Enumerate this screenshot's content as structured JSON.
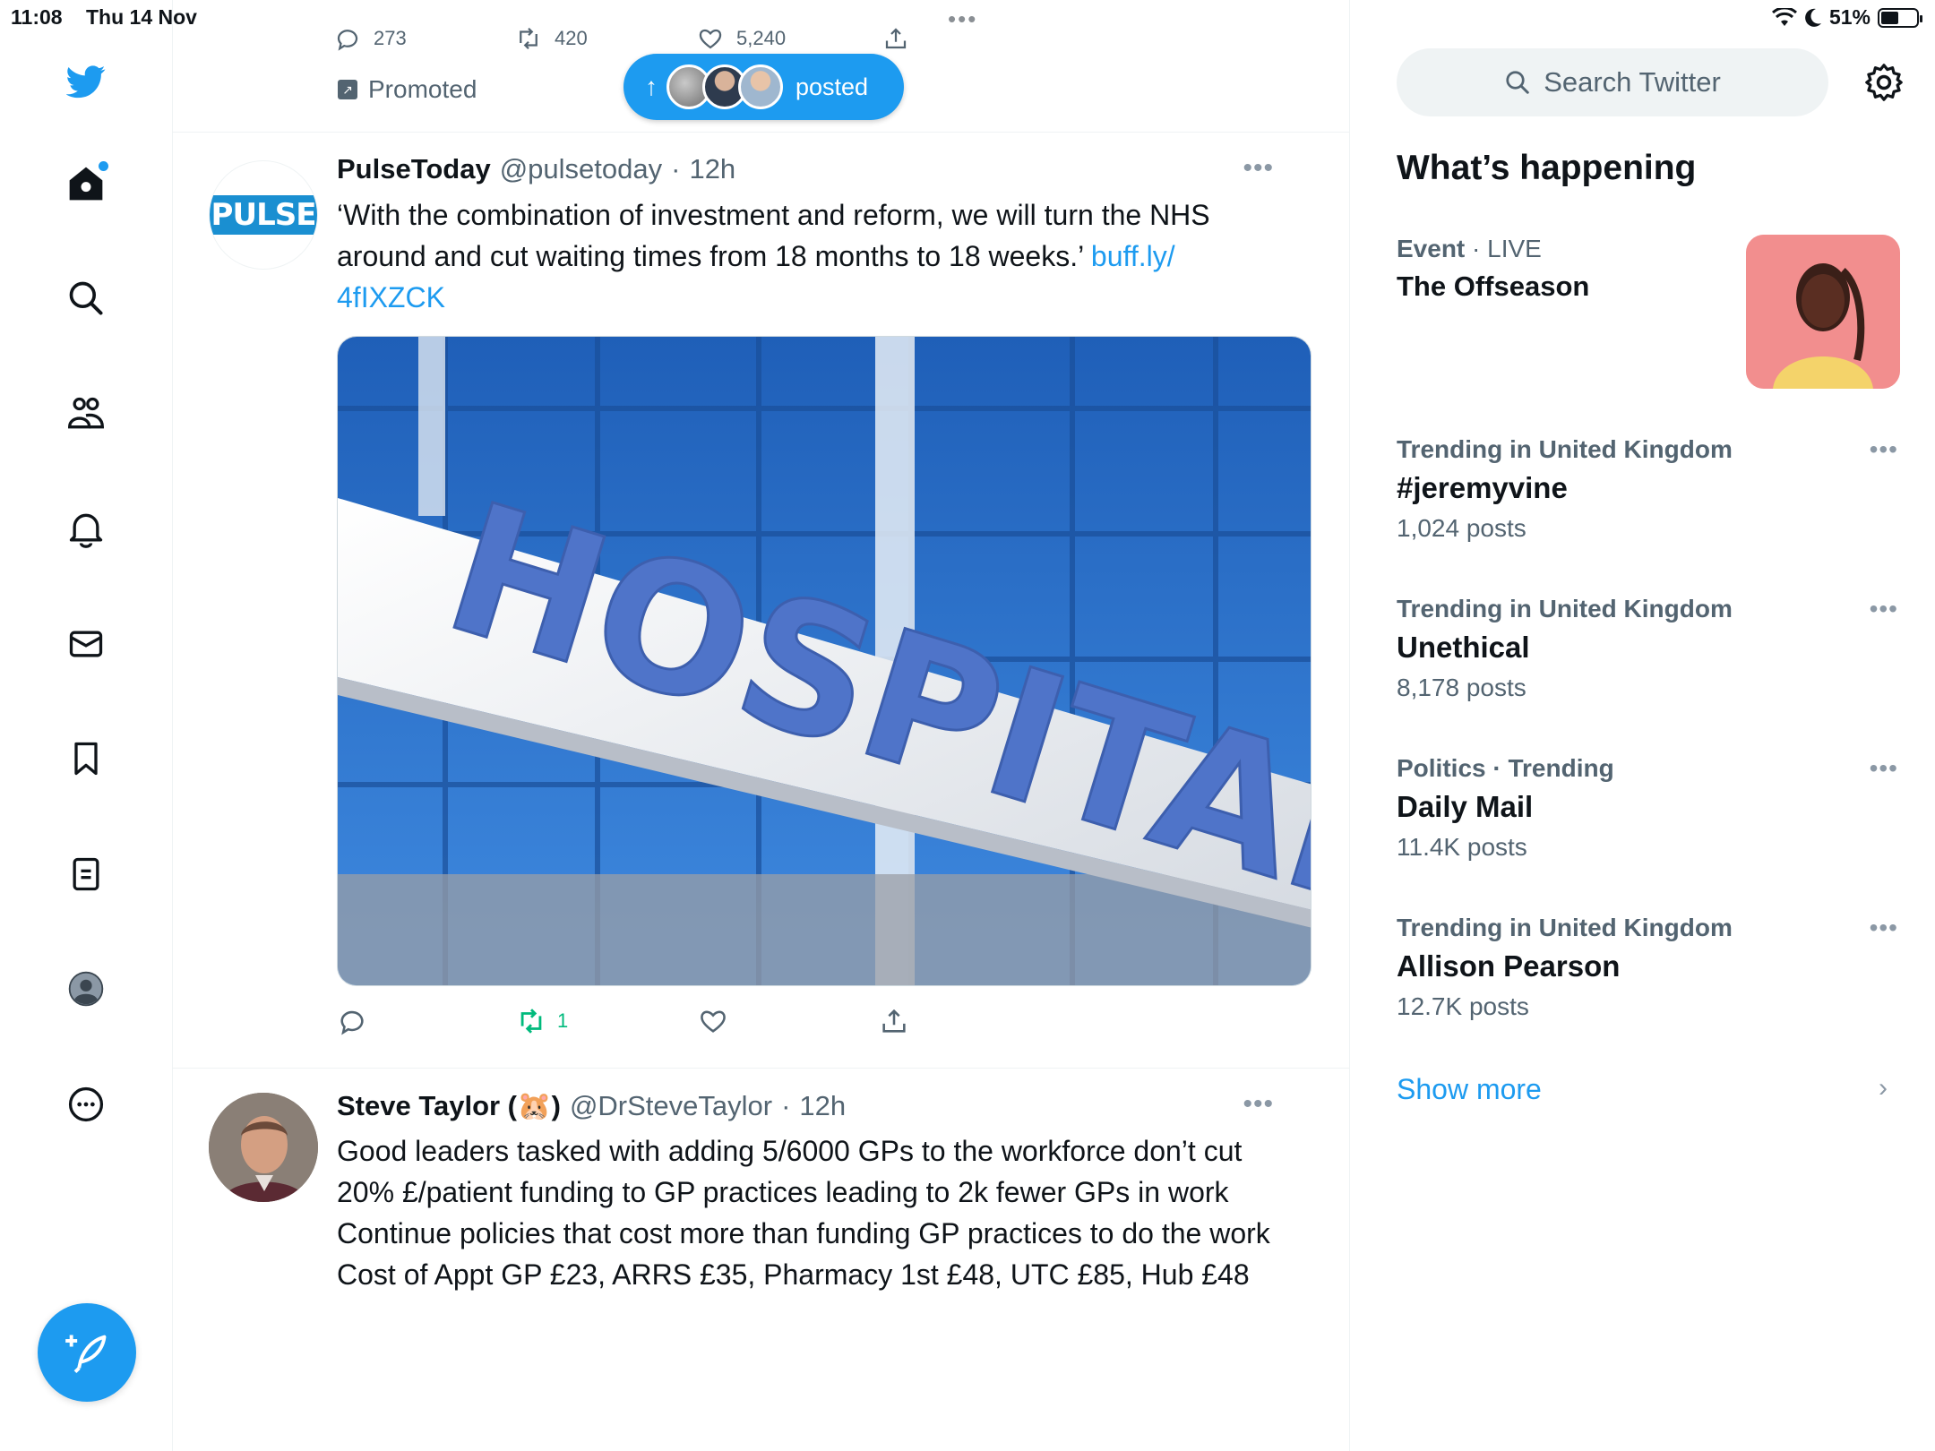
{
  "status_bar": {
    "time": "11:08",
    "date": "Thu 14 Nov",
    "battery": "51%",
    "battery_level": 0.51,
    "dots": "•••"
  },
  "promoted_tweet": {
    "reply_count": "273",
    "retweet_count": "420",
    "like_count": "5,240",
    "promoted_label": "Promoted"
  },
  "new_posts_pill": {
    "label": "posted"
  },
  "tweets": [
    {
      "name": "PulseToday",
      "handle": "@pulsetoday",
      "dot": "·",
      "time": "12h",
      "avatar_text": "PULSE",
      "text": "‘With the combination of investment and reform, we will turn the NHS around and cut waiting times from 18 months to 18 weeks.’ ",
      "link": "buff.ly/\n4fIXZCK",
      "media_text": "HOSPITAL",
      "retweet_count": "1",
      "more": "•••"
    },
    {
      "name": "Steve Taylor (🐹)",
      "handle": "@DrSteveTaylor",
      "dot": "·",
      "time": "12h",
      "text_lines": [
        "Good leaders tasked with adding 5/6000 GPs to the workforce don’t cut 20% £/patient funding to GP practices leading to 2k fewer GPs in work",
        "Continue policies that cost more than funding GP practices to do the work",
        "Cost of Appt GP £23, ARRS £35, Pharmacy 1st £48, UTC £85, Hub £48"
      ],
      "more": "•••"
    }
  ],
  "sidebar": {
    "search_placeholder": "Search Twitter",
    "whats_happening": "What’s happening",
    "event": {
      "category": "Event",
      "dot": "·",
      "status": "LIVE",
      "title": "The Offseason"
    },
    "trends": [
      {
        "meta": "Trending in United Kingdom",
        "title": "#jeremyvine",
        "count": "1,024 posts"
      },
      {
        "meta": "Trending in United Kingdom",
        "title": "Unethical",
        "count": "8,178 posts"
      },
      {
        "meta": "Politics · Trending",
        "title": "Daily Mail",
        "count": "11.4K posts"
      },
      {
        "meta": "Trending in United Kingdom",
        "title": "Allison Pearson",
        "count": "12.7K posts"
      }
    ],
    "show_more": "Show more",
    "trend_more": "•••"
  },
  "colors": {
    "accent": "#1d9bf0",
    "text": "#0f1419",
    "muted": "#536471",
    "retweet": "#00ba7c"
  },
  "icons": {
    "nav": [
      "twitter-bird-icon",
      "home-icon",
      "search-icon",
      "communities-icon",
      "bell-icon",
      "mail-icon",
      "bookmark-icon",
      "lists-icon",
      "profile-icon",
      "more-circle-icon"
    ],
    "compose": "compose-feather-icon"
  }
}
